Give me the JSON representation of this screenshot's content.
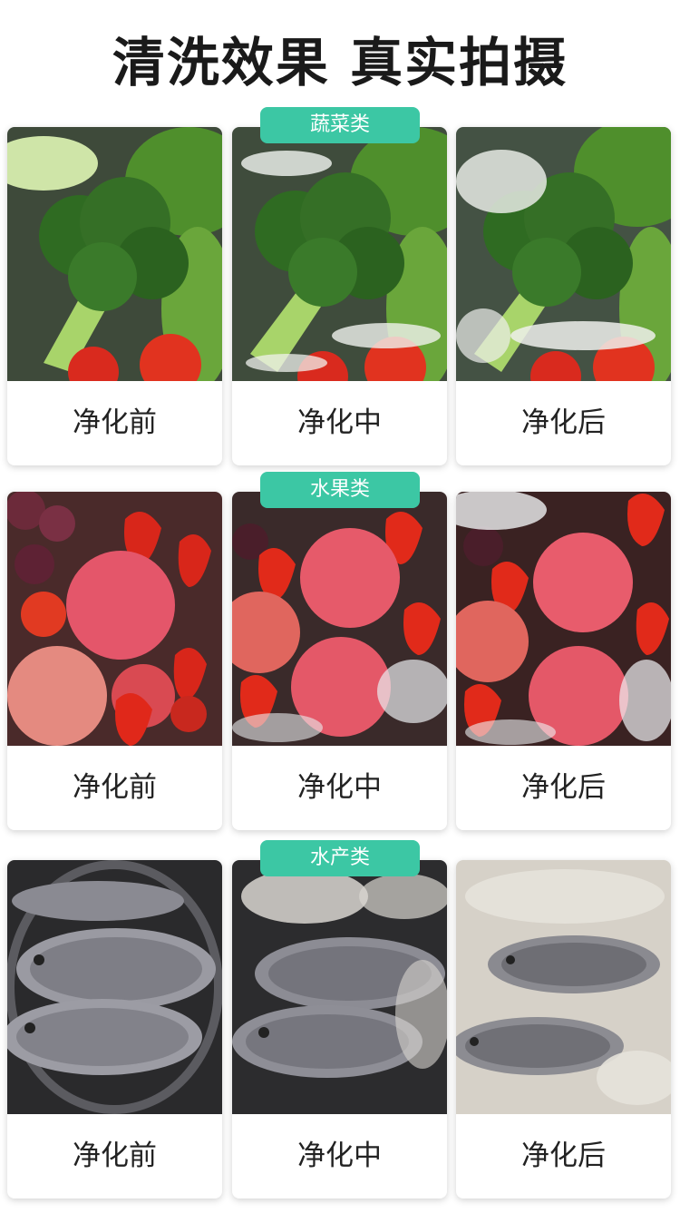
{
  "title": "清洗效果 真实拍摄",
  "accent_color": "#3cc7a4",
  "sections": [
    {
      "tag": "蔬菜类",
      "icon": "vegetables-photo",
      "captions": [
        "净化前",
        "净化中",
        "净化后"
      ]
    },
    {
      "tag": "水果类",
      "icon": "fruits-photo",
      "captions": [
        "净化前",
        "净化中",
        "净化后"
      ]
    },
    {
      "tag": "水产类",
      "icon": "fish-photo",
      "captions": [
        "净化前",
        "净化中",
        "净化后"
      ]
    }
  ]
}
